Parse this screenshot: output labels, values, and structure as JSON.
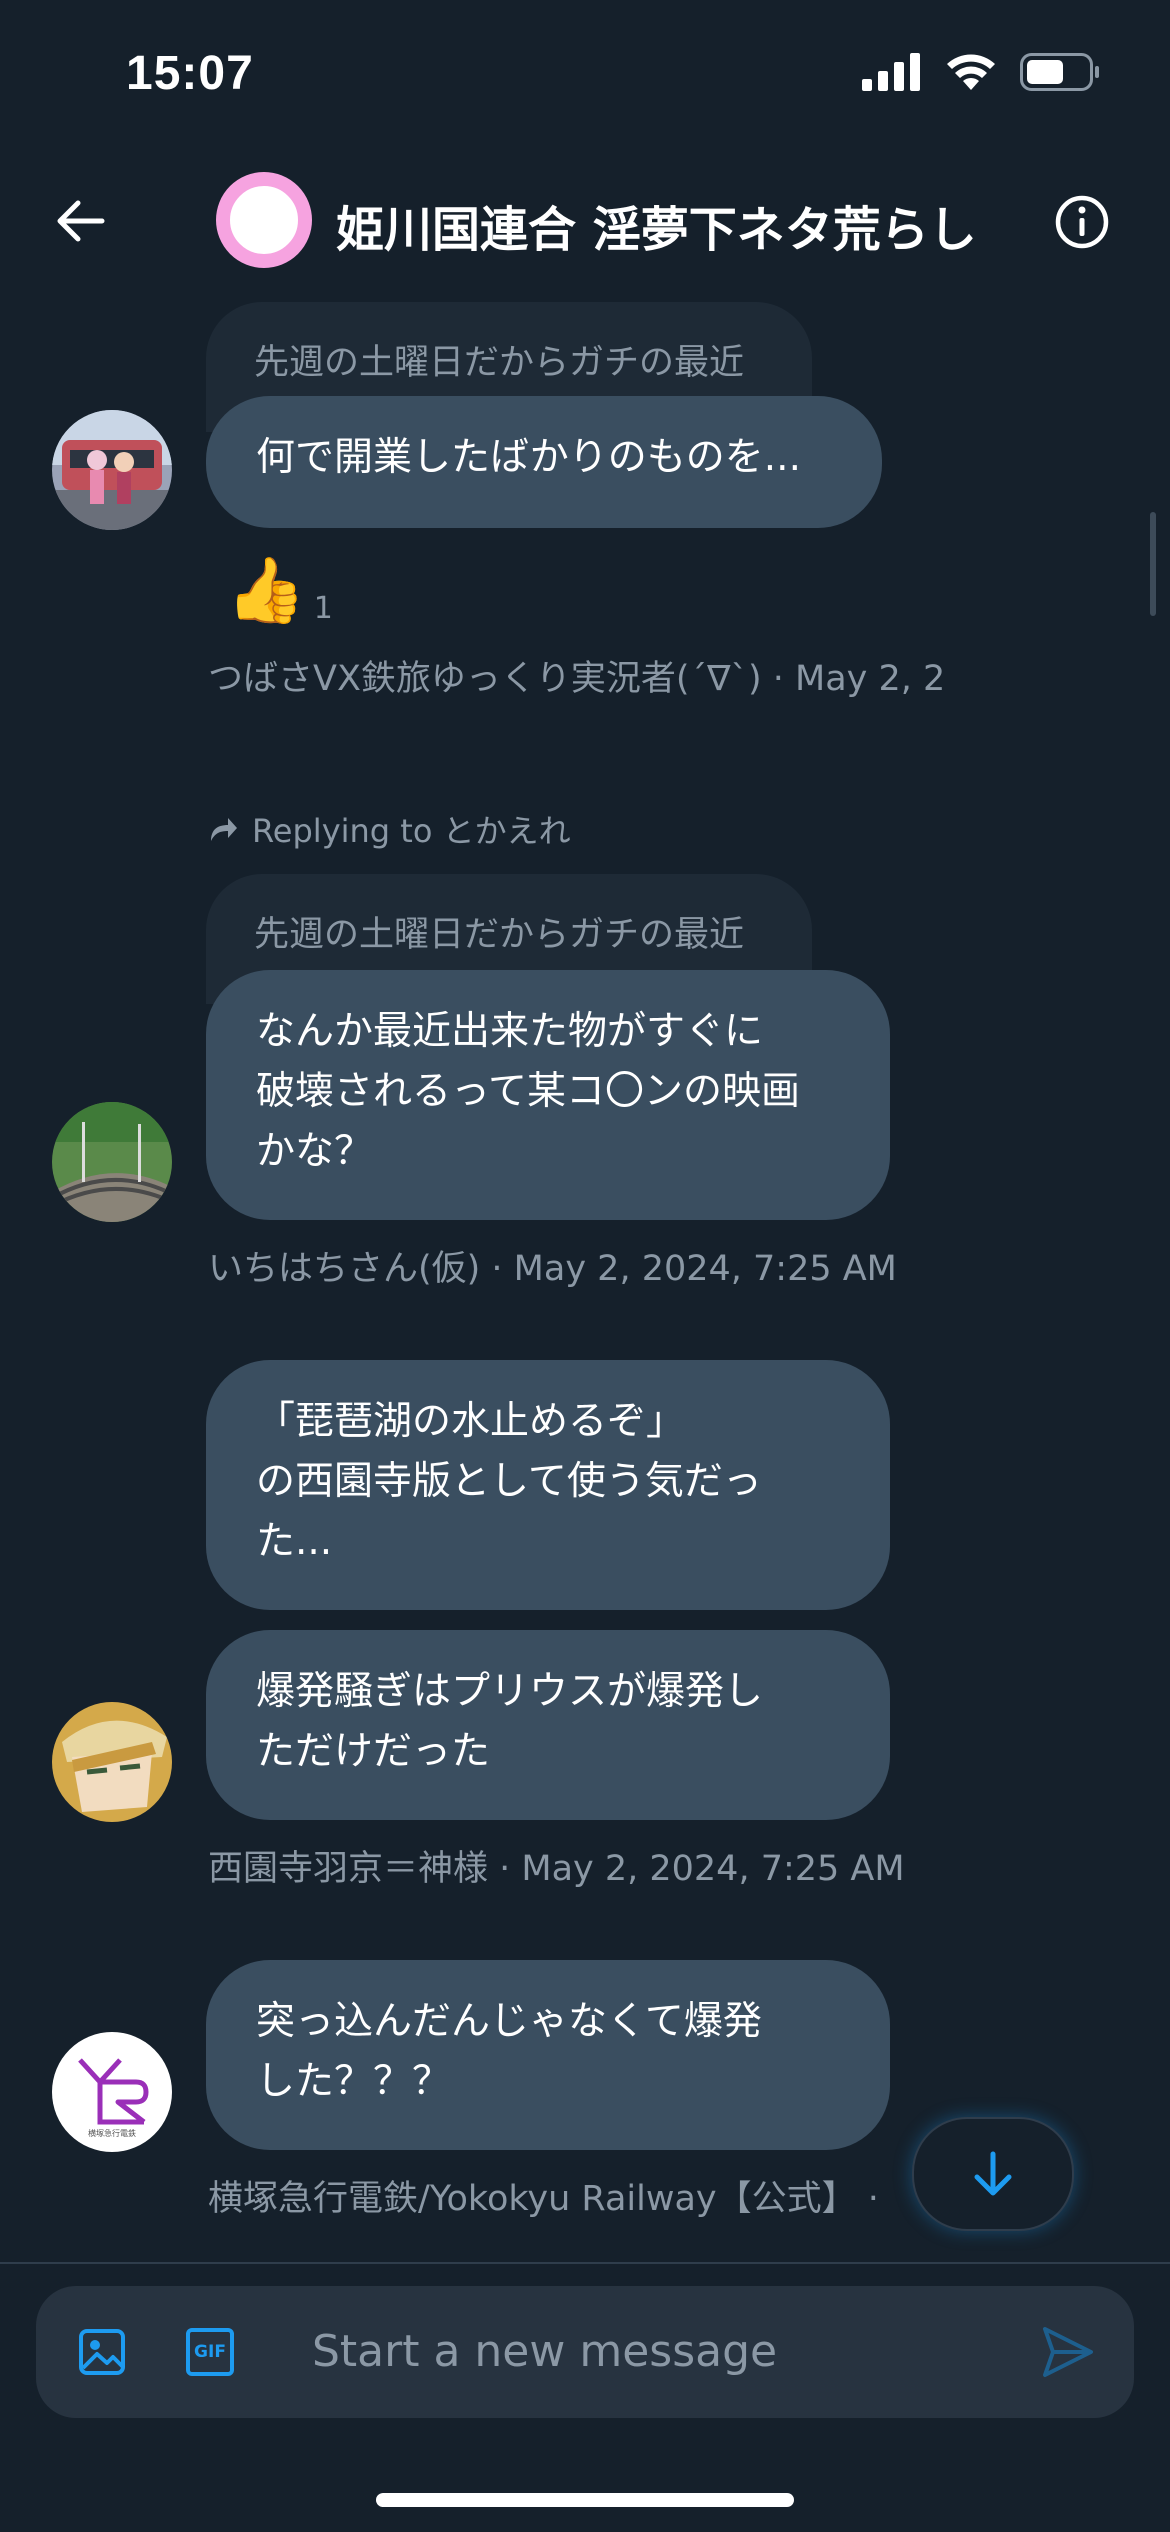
{
  "status_bar": {
    "time": "15:07"
  },
  "header": {
    "title": "姫川国連合 淫夢下ネタ荒らし"
  },
  "messages": [
    {
      "quote": "先週の土曜日だからガチの最近",
      "bubbles": [
        "何で開業したばかりのものを..."
      ],
      "reaction": {
        "emoji": "👍",
        "count": "1"
      },
      "meta": "つばさVX鉄旅ゆっくり実況者(´∇`) · May 2, 2"
    },
    {
      "replying_to": "Replying to とかえれ",
      "quote": "先週の土曜日だからガチの最近",
      "bubbles": [
        "なんか最近出来た物がすぐに\n破壊されるって某コ〇ンの映画\nかな？"
      ],
      "meta": "いちはちさん(仮) · May 2, 2024, 7:25 AM"
    },
    {
      "bubbles": [
        "「琵琶湖の水止めるぞ」\nの西園寺版として使う気だっ\nた...",
        "爆発騒ぎはプリウスが爆発し\nただけだった"
      ],
      "meta": "西園寺羽京＝神様 · May 2, 2024, 7:25 AM"
    },
    {
      "bubbles": [
        "突っ込んだんじゃなくて爆発\nした？？？"
      ],
      "meta": "横塚急行電鉄/Yokokyu Railway【公式】 · ",
      "avatar_logo_text": "横塚急行電鉄"
    }
  ],
  "composer": {
    "placeholder": "Start a new message",
    "gif_label": "GIF"
  },
  "colors": {
    "accent": "#1d9bf0",
    "background": "#15202b",
    "bubble": "#3a4e60",
    "muted": "#8b98a5"
  }
}
